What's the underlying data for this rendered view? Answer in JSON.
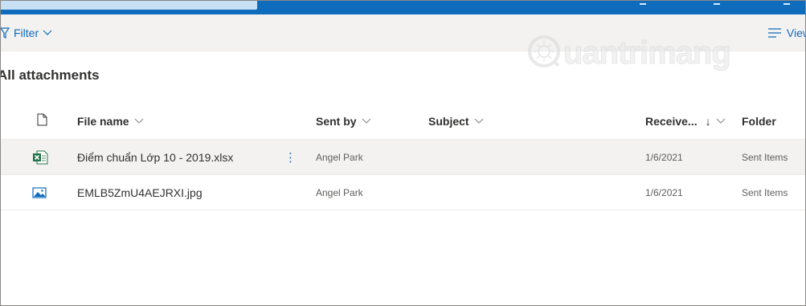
{
  "toolbar": {
    "filter_label": "Filter",
    "view_label": "View"
  },
  "watermark": {
    "text": "uantrimang"
  },
  "page": {
    "title": "All attachments"
  },
  "columns": {
    "file_name": "File name",
    "sent_by": "Sent by",
    "subject": "Subject",
    "received": "Receive...",
    "sort_indicator": "↓",
    "folder": "Folder"
  },
  "rows": [
    {
      "file_icon": "excel-file-icon",
      "file_name": "Điểm chuẩn Lớp 10 - 2019.xlsx",
      "more_label": "⋮",
      "sent_by": "Angel Park",
      "subject": "",
      "received": "1/6/2021",
      "folder": "Sent Items"
    },
    {
      "file_icon": "image-file-icon",
      "file_name": "EMLB5ZmU4AEJRXI.jpg",
      "sent_by": "Angel Park",
      "subject": "",
      "received": "1/6/2021",
      "folder": "Sent Items"
    }
  ],
  "colors": {
    "accent": "#0f6cbd",
    "topbar": "#0f6cbd",
    "excel_green": "#217346"
  }
}
